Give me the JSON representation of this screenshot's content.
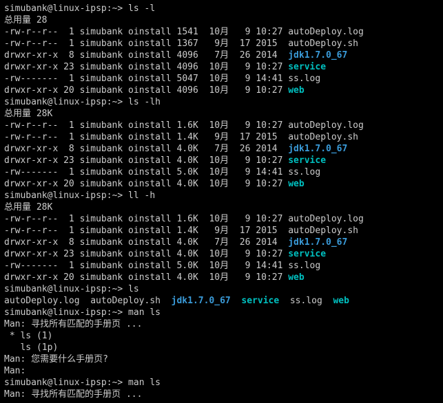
{
  "prompt": {
    "user": "simubank",
    "host": "linux-ipsp",
    "path": "~",
    "suffix": "> "
  },
  "cmds": {
    "ls_l": "ls -l",
    "ls_lh": "ls -lh",
    "ll_h": "ll -h",
    "ls": "ls",
    "man_ls": "man ls"
  },
  "totals": {
    "t1": "总用量 28",
    "t2": "总用量 28K",
    "t3": "总用量 28K"
  },
  "listing1": [
    {
      "perm": "-rw-r--r--",
      "links": " 1",
      "own": "simubank",
      "grp": "oinstall",
      "size": "1541",
      "mon": "10月",
      "day": "  9",
      "time": "10:27",
      "name": "autoDeploy.log",
      "cls": "fn"
    },
    {
      "perm": "-rw-r--r--",
      "links": " 1",
      "own": "simubank",
      "grp": "oinstall",
      "size": "1367",
      "mon": " 9月",
      "day": " 17",
      "time": "2015 ",
      "name": "autoDeploy.sh",
      "cls": "fn"
    },
    {
      "perm": "drwxr-xr-x",
      "links": " 8",
      "own": "simubank",
      "grp": "oinstall",
      "size": "4096",
      "mon": " 7月",
      "day": " 26",
      "time": "2014 ",
      "name": "jdk1.7.0_67",
      "cls": "dir"
    },
    {
      "perm": "drwxr-xr-x",
      "links": "23",
      "own": "simubank",
      "grp": "oinstall",
      "size": "4096",
      "mon": "10月",
      "day": "  9",
      "time": "10:27",
      "name": "service",
      "cls": "svc"
    },
    {
      "perm": "-rw-------",
      "links": " 1",
      "own": "simubank",
      "grp": "oinstall",
      "size": "5047",
      "mon": "10月",
      "day": "  9",
      "time": "14:41",
      "name": "ss.log",
      "cls": "fn"
    },
    {
      "perm": "drwxr-xr-x",
      "links": "20",
      "own": "simubank",
      "grp": "oinstall",
      "size": "4096",
      "mon": "10月",
      "day": "  9",
      "time": "10:27",
      "name": "web",
      "cls": "svc"
    }
  ],
  "listing2": [
    {
      "perm": "-rw-r--r--",
      "links": " 1",
      "own": "simubank",
      "grp": "oinstall",
      "size": "1.6K",
      "mon": "10月",
      "day": "  9",
      "time": "10:27",
      "name": "autoDeploy.log",
      "cls": "fn"
    },
    {
      "perm": "-rw-r--r--",
      "links": " 1",
      "own": "simubank",
      "grp": "oinstall",
      "size": "1.4K",
      "mon": " 9月",
      "day": " 17",
      "time": "2015 ",
      "name": "autoDeploy.sh",
      "cls": "fn"
    },
    {
      "perm": "drwxr-xr-x",
      "links": " 8",
      "own": "simubank",
      "grp": "oinstall",
      "size": "4.0K",
      "mon": " 7月",
      "day": " 26",
      "time": "2014 ",
      "name": "jdk1.7.0_67",
      "cls": "dir"
    },
    {
      "perm": "drwxr-xr-x",
      "links": "23",
      "own": "simubank",
      "grp": "oinstall",
      "size": "4.0K",
      "mon": "10月",
      "day": "  9",
      "time": "10:27",
      "name": "service",
      "cls": "svc"
    },
    {
      "perm": "-rw-------",
      "links": " 1",
      "own": "simubank",
      "grp": "oinstall",
      "size": "5.0K",
      "mon": "10月",
      "day": "  9",
      "time": "14:41",
      "name": "ss.log",
      "cls": "fn"
    },
    {
      "perm": "drwxr-xr-x",
      "links": "20",
      "own": "simubank",
      "grp": "oinstall",
      "size": "4.0K",
      "mon": "10月",
      "day": "  9",
      "time": "10:27",
      "name": "web",
      "cls": "svc"
    }
  ],
  "listing3": [
    {
      "perm": "-rw-r--r--",
      "links": " 1",
      "own": "simubank",
      "grp": "oinstall",
      "size": "1.6K",
      "mon": "10月",
      "day": "  9",
      "time": "10:27",
      "name": "autoDeploy.log",
      "cls": "fn"
    },
    {
      "perm": "-rw-r--r--",
      "links": " 1",
      "own": "simubank",
      "grp": "oinstall",
      "size": "1.4K",
      "mon": " 9月",
      "day": " 17",
      "time": "2015 ",
      "name": "autoDeploy.sh",
      "cls": "fn"
    },
    {
      "perm": "drwxr-xr-x",
      "links": " 8",
      "own": "simubank",
      "grp": "oinstall",
      "size": "4.0K",
      "mon": " 7月",
      "day": " 26",
      "time": "2014 ",
      "name": "jdk1.7.0_67",
      "cls": "dir"
    },
    {
      "perm": "drwxr-xr-x",
      "links": "23",
      "own": "simubank",
      "grp": "oinstall",
      "size": "4.0K",
      "mon": "10月",
      "day": "  9",
      "time": "10:27",
      "name": "service",
      "cls": "svc"
    },
    {
      "perm": "-rw-------",
      "links": " 1",
      "own": "simubank",
      "grp": "oinstall",
      "size": "5.0K",
      "mon": "10月",
      "day": "  9",
      "time": "14:41",
      "name": "ss.log",
      "cls": "fn"
    },
    {
      "perm": "drwxr-xr-x",
      "links": "20",
      "own": "simubank",
      "grp": "oinstall",
      "size": "4.0K",
      "mon": "10月",
      "day": "  9",
      "time": "10:27",
      "name": "web",
      "cls": "svc"
    }
  ],
  "ls_short": [
    {
      "name": "autoDeploy.log",
      "cls": "fn"
    },
    {
      "name": "autoDeploy.sh",
      "cls": "fn"
    },
    {
      "name": "jdk1.7.0_67",
      "cls": "dir"
    },
    {
      "name": "service",
      "cls": "svc"
    },
    {
      "name": "ss.log",
      "cls": "fn"
    },
    {
      "name": "web",
      "cls": "svc"
    }
  ],
  "man": {
    "search": "Man: 寻找所有匹配的手册页 ...",
    "opt_sel": " * ls (1)",
    "opt_oth": "   ls (1p)",
    "ask": "Man: 您需要什么手册页?",
    "blank": "Man:",
    "search2": "Man: 寻找所有匹配的手册页 ..."
  }
}
